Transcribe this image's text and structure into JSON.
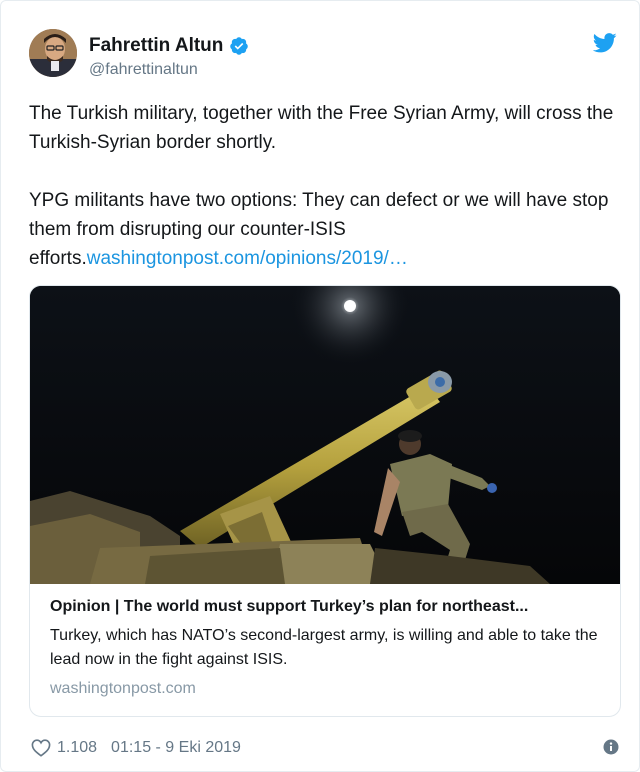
{
  "author": {
    "name": "Fahrettin Altun",
    "handle": "@fahrettinaltun"
  },
  "tweet": {
    "paragraph1": "The Turkish military, together with the Free Syrian Army, will cross the Turkish-Syrian border shortly.",
    "paragraph2_text": "YPG militants have two options: They can defect or we will have stop them from disrupting our counter-ISIS efforts.",
    "paragraph2_link": "washingtonpost.com/opinions/2019/…"
  },
  "card": {
    "title": "Opinion | The world must support Turkey’s plan for northeast...",
    "description": "Turkey, which has NATO’s second-largest army, is willing and able to take the lead now in the fight against ISIS.",
    "domain": "washingtonpost.com"
  },
  "footer": {
    "likes": "1.108",
    "timestamp": "01:15 - 9 Eki 2019"
  },
  "colors": {
    "link": "#1b95e0",
    "verified": "#1da1f2",
    "twitter_brand": "#1da1f2",
    "muted": "#657786"
  },
  "icons": {
    "verified": "verified-badge-icon",
    "brand": "twitter-bird-icon",
    "like": "heart-icon",
    "info": "info-icon"
  }
}
